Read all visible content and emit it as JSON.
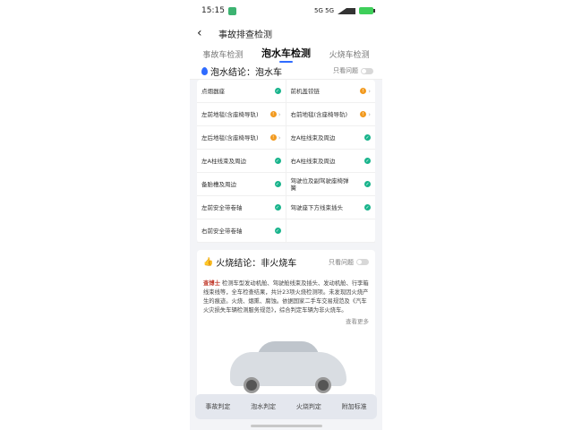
{
  "statusbar": {
    "time": "15:15",
    "indicators": "5G 5G"
  },
  "header": {
    "back_icon": "back-arrow-icon",
    "title": "事故排查检测"
  },
  "tabs": [
    {
      "label": "事故车检测"
    },
    {
      "label": "泡水车检测"
    },
    {
      "label": "火烧车检测"
    }
  ],
  "water": {
    "verdict_label": "泡水结论：泡水车",
    "toggle_label": "只看问题"
  },
  "checks": [
    {
      "label": "点烟器座",
      "status": "ok"
    },
    {
      "label": "前机盖铰链",
      "status": "warn"
    },
    {
      "label": "左前地毯(含座椅导轨)",
      "status": "warn"
    },
    {
      "label": "右前地毯(含座椅导轨)",
      "status": "warn"
    },
    {
      "label": "左后地毯(含座椅导轨)",
      "status": "warn"
    },
    {
      "label": "左A柱线束及周边",
      "status": "ok"
    },
    {
      "label": "左A柱线束及周边",
      "status": "ok"
    },
    {
      "label": "右A柱线束及周边",
      "status": "ok"
    },
    {
      "label": "备胎槽及周边",
      "status": "ok"
    },
    {
      "label": "驾驶位及副驾驶座椅弹簧",
      "status": "ok"
    },
    {
      "label": "左前安全带卷轴",
      "status": "ok"
    },
    {
      "label": "驾驶座下方线束插头",
      "status": "ok"
    },
    {
      "label": "右前安全带卷轴",
      "status": "ok"
    },
    {
      "label": "",
      "status": ""
    }
  ],
  "fire": {
    "title": "火烧结论：非火烧车",
    "toggle_label": "只看问题",
    "brand": "查博士",
    "description": "检测车型发动机舱、驾驶舱线束及插头、发动机舱、行李箱线束线等，全车检查结果，共计23项火烧检测项。未发现因火烧产生的痕迹。火烧、烟熏、腐蚀。依据国家二手车交易规范及《汽车火灾损失车辆检测服务规范》，综合判定车辆为非火烧车。",
    "more_label": "查看更多"
  },
  "bottom_nav": [
    "事故判定",
    "泡水判定",
    "火烧判定",
    "附加标准"
  ]
}
